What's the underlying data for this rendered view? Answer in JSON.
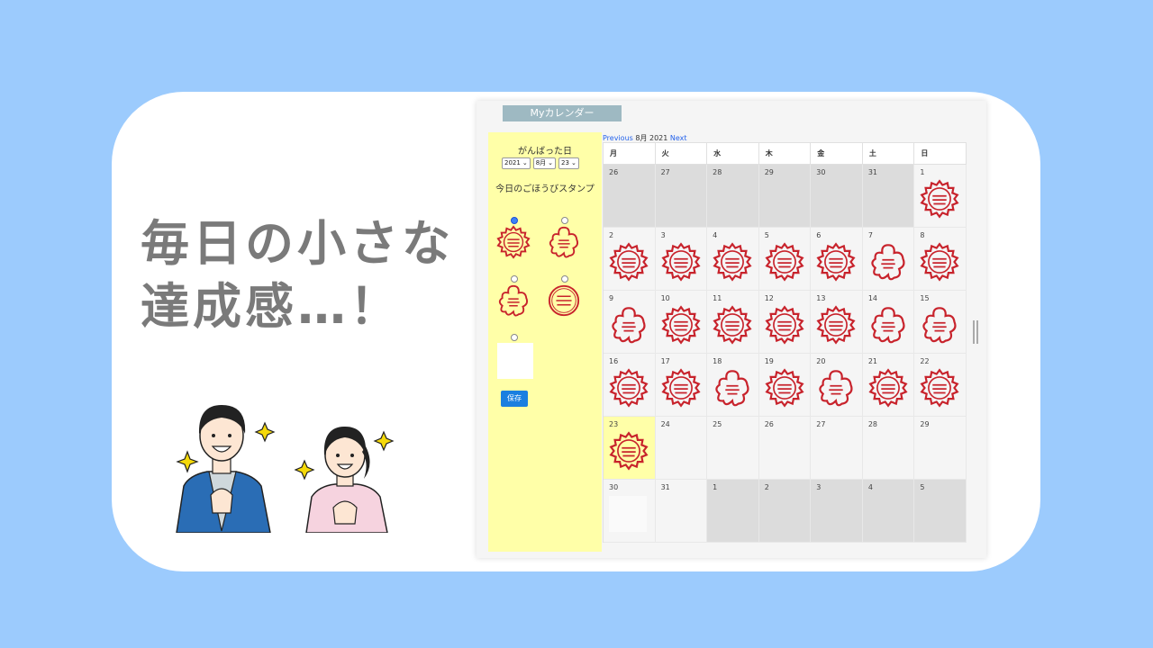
{
  "headline": {
    "line1": "毎日の小さな",
    "line2": "達成感…！"
  },
  "app": {
    "title": "Myカレンダー",
    "sidebar": {
      "date_label": "がんばった日",
      "year": "2021",
      "month": "8月",
      "day": "23",
      "stamp_label": "今日のごほうびスタンプ",
      "selected_option": 1,
      "save_label": "保存"
    },
    "nav": {
      "prev": "Previous",
      "month": "8月 2021",
      "next": "Next"
    },
    "weekdays": [
      "月",
      "火",
      "水",
      "木",
      "金",
      "土",
      "日"
    ],
    "stamp_colors": {
      "red": "#c8232c"
    },
    "days": [
      {
        "n": "26",
        "other": true,
        "stamp": ""
      },
      {
        "n": "27",
        "other": true,
        "stamp": ""
      },
      {
        "n": "28",
        "other": true,
        "stamp": ""
      },
      {
        "n": "29",
        "other": true,
        "stamp": ""
      },
      {
        "n": "30",
        "other": true,
        "stamp": ""
      },
      {
        "n": "31",
        "other": true,
        "stamp": ""
      },
      {
        "n": "1",
        "other": false,
        "stamp": "gear"
      },
      {
        "n": "2",
        "other": false,
        "stamp": "gear"
      },
      {
        "n": "3",
        "other": false,
        "stamp": "gear"
      },
      {
        "n": "4",
        "other": false,
        "stamp": "gear"
      },
      {
        "n": "5",
        "other": false,
        "stamp": "gear"
      },
      {
        "n": "6",
        "other": false,
        "stamp": "gear"
      },
      {
        "n": "7",
        "other": false,
        "stamp": "flower"
      },
      {
        "n": "8",
        "other": false,
        "stamp": "gear"
      },
      {
        "n": "9",
        "other": false,
        "stamp": "flower"
      },
      {
        "n": "10",
        "other": false,
        "stamp": "gear"
      },
      {
        "n": "11",
        "other": false,
        "stamp": "gear"
      },
      {
        "n": "12",
        "other": false,
        "stamp": "gear"
      },
      {
        "n": "13",
        "other": false,
        "stamp": "gear"
      },
      {
        "n": "14",
        "other": false,
        "stamp": "flower"
      },
      {
        "n": "15",
        "other": false,
        "stamp": "flower"
      },
      {
        "n": "16",
        "other": false,
        "stamp": "gear"
      },
      {
        "n": "17",
        "other": false,
        "stamp": "gear"
      },
      {
        "n": "18",
        "other": false,
        "stamp": "flower"
      },
      {
        "n": "19",
        "other": false,
        "stamp": "gear"
      },
      {
        "n": "20",
        "other": false,
        "stamp": "flower"
      },
      {
        "n": "21",
        "other": false,
        "stamp": "gear"
      },
      {
        "n": "22",
        "other": false,
        "stamp": "gear"
      },
      {
        "n": "23",
        "other": false,
        "today": true,
        "stamp": "gear"
      },
      {
        "n": "24",
        "other": false,
        "stamp": ""
      },
      {
        "n": "25",
        "other": false,
        "stamp": ""
      },
      {
        "n": "26",
        "other": false,
        "stamp": ""
      },
      {
        "n": "27",
        "other": false,
        "stamp": ""
      },
      {
        "n": "28",
        "other": false,
        "stamp": ""
      },
      {
        "n": "29",
        "other": false,
        "stamp": ""
      },
      {
        "n": "30",
        "other": false,
        "stamp": "blank"
      },
      {
        "n": "31",
        "other": false,
        "stamp": ""
      },
      {
        "n": "1",
        "other": true,
        "stamp": ""
      },
      {
        "n": "2",
        "other": true,
        "stamp": ""
      },
      {
        "n": "3",
        "other": true,
        "stamp": ""
      },
      {
        "n": "4",
        "other": true,
        "stamp": ""
      },
      {
        "n": "5",
        "other": true,
        "stamp": ""
      }
    ]
  }
}
